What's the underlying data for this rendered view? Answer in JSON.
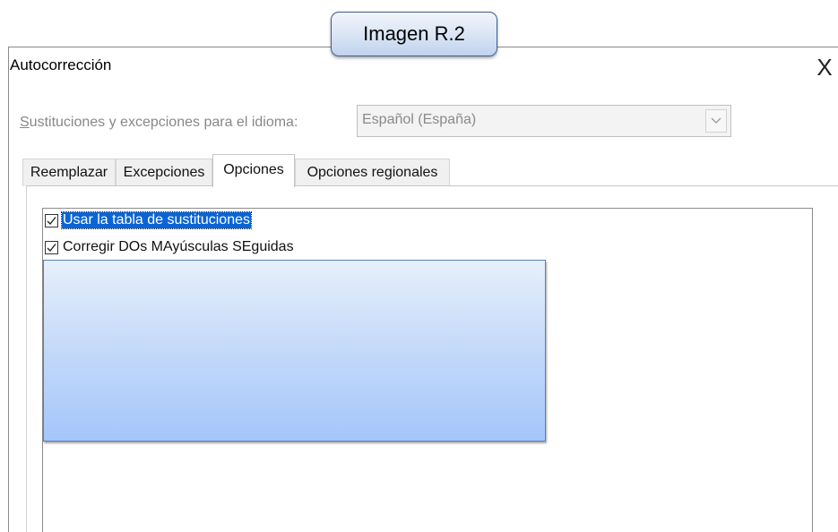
{
  "callout": {
    "label": "Imagen R.2"
  },
  "dialog": {
    "title": "Autocorrección",
    "close_glyph": "X"
  },
  "language": {
    "label": "Sustituciones y excepciones para el idioma:",
    "selected": "Español (España)"
  },
  "tabs": [
    {
      "label": "Reemplazar",
      "active": false
    },
    {
      "label": "Excepciones",
      "active": false
    },
    {
      "label": "Opciones",
      "active": true
    },
    {
      "label": "Opciones regionales",
      "active": false
    }
  ],
  "options": [
    {
      "label": "Usar la tabla de sustituciones",
      "checked": true,
      "selected": true
    },
    {
      "label": "Corregir DOs MAyúsculas SEguidas",
      "checked": true,
      "selected": false
    }
  ],
  "colors": {
    "selection": "#0a64d6",
    "overlay_top": "#e7effb",
    "overlay_bottom": "#a4c6fb",
    "callout_border": "#3b5f95"
  }
}
